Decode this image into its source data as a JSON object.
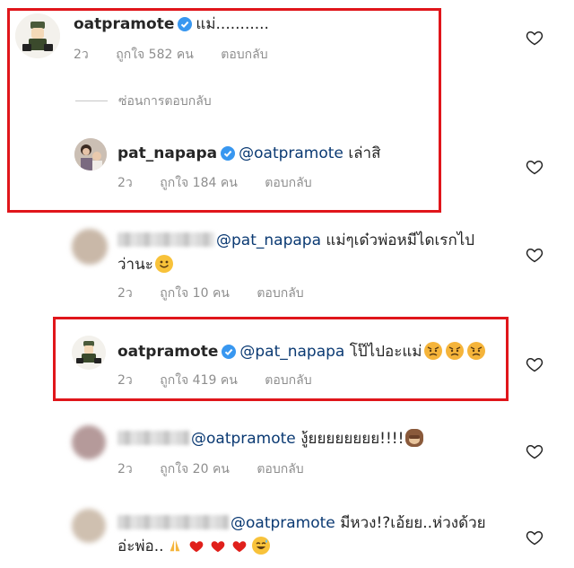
{
  "comments": [
    {
      "username": "oatpramote",
      "text": "แม่...........",
      "time": "2ว",
      "likes": "ถูกใจ 582 คน",
      "reply": "ตอบกลับ"
    },
    {
      "hide_replies": "ซ่อนการตอบกลับ"
    },
    {
      "username": "pat_napapa",
      "mention": "@oatpramote",
      "text": "เล่าสิ",
      "time": "2ว",
      "likes": "ถูกใจ 184 คน",
      "reply": "ตอบกลับ"
    },
    {
      "mention": "@pat_napapa",
      "text": "แม่ๆเด๋วพ่อหมีไดเรกไป",
      "text2": "ว่านะ",
      "time": "2ว",
      "likes": "ถูกใจ 10 คน",
      "reply": "ตอบกลับ"
    },
    {
      "username": "oatpramote",
      "mention": "@pat_napapa",
      "text": "โป๊ไปอะแม่",
      "time": "2ว",
      "likes": "ถูกใจ 419 คน",
      "reply": "ตอบกลับ"
    },
    {
      "mention": "@oatpramote",
      "text": "งู้ยยยยยยยย!!!!",
      "time": "2ว",
      "likes": "ถูกใจ 20 คน",
      "reply": "ตอบกลับ"
    },
    {
      "mention": "@oatpramote",
      "text": "มีหวง!?เอ้ยย..ห่วงด้วย",
      "text2": "อ่ะพ่อ..",
      "time": "",
      "likes": "",
      "reply": ""
    }
  ],
  "colors": {
    "highlight_border": "#e0161b",
    "verified": "#3897f0",
    "mention": "#0b3a73",
    "meta": "#8e8e8e"
  },
  "icons": {
    "like": "heart-outline-icon",
    "verified": "verified-badge-icon"
  }
}
